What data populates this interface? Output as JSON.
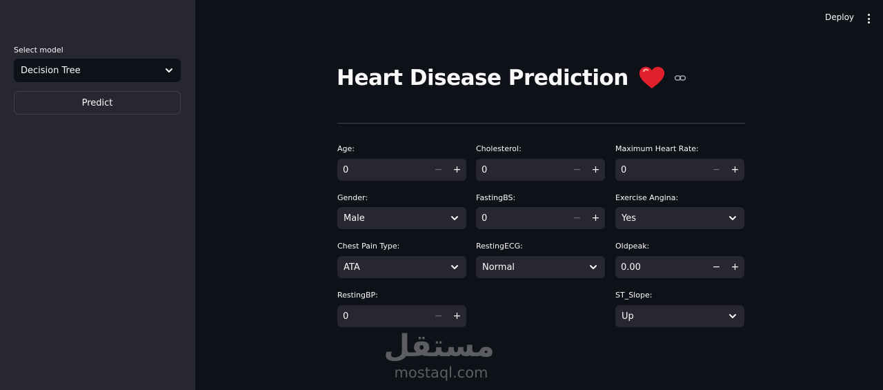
{
  "sidebar": {
    "select_label": "Select model",
    "model_value": "Decision Tree",
    "predict_label": "Predict"
  },
  "header": {
    "deploy_label": "Deploy"
  },
  "main": {
    "title": "Heart Disease Prediction",
    "fields": {
      "age": {
        "label": "Age:",
        "value": "0"
      },
      "cholesterol": {
        "label": "Cholesterol:",
        "value": "0"
      },
      "max_hr": {
        "label": "Maximum Heart Rate:",
        "value": "0"
      },
      "gender": {
        "label": "Gender:",
        "value": "Male"
      },
      "fasting_bs": {
        "label": "FastingBS:",
        "value": "0"
      },
      "exercise_angina": {
        "label": "Exercise Angina:",
        "value": "Yes"
      },
      "chest_pain": {
        "label": "Chest Pain Type:",
        "value": "ATA"
      },
      "resting_ecg": {
        "label": "RestingECG:",
        "value": "Normal"
      },
      "oldpeak": {
        "label": "Oldpeak:",
        "value": "0.00"
      },
      "resting_bp": {
        "label": "RestingBP:",
        "value": "0"
      },
      "st_slope": {
        "label": "ST_Slope:",
        "value": "Up"
      }
    },
    "stepper": {
      "minus": "−",
      "plus": "+"
    }
  },
  "watermark": {
    "arabic": "مستقل",
    "latin": "mostaql.com"
  },
  "colors": {
    "background": "#0e1117",
    "sidebar": "#262730",
    "input": "#262730",
    "heart": "#e0202a"
  }
}
